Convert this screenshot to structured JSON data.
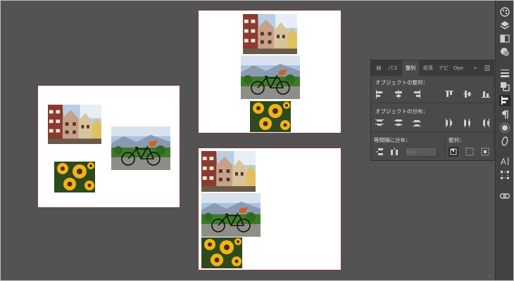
{
  "panel": {
    "tabs": [
      {
        "label": "線",
        "active": false
      },
      {
        "label": "パス",
        "active": false
      },
      {
        "label": "整列",
        "active": true
      },
      {
        "label": "段落",
        "active": false
      },
      {
        "label": "アピ",
        "active": false
      },
      {
        "label": "Ope",
        "active": false
      }
    ],
    "more": "»",
    "menu_icon": "panel-menu-icon",
    "align_objects_label": "オブジェクトの整列：",
    "distribute_objects_label": "オブジェクトの分布：",
    "distribute_spacing_label": "等間隔に分布：",
    "align_to_label": "整列：",
    "spacing_value": "0 px"
  },
  "toolbar_icons": [
    "color-palette-icon",
    "layers-icon",
    "gradient-icon",
    "appearance-icon",
    "stroke-icon",
    "pathfinder-icon",
    "align-icon",
    "paragraph-icon",
    "brightness-icon",
    "glyph-icon",
    "character-icon",
    "transform-icon",
    "links-icon"
  ],
  "colors": {
    "canvas": "#535353",
    "artboard_border": "#6a4848",
    "panel_bg": "#4a4a4a",
    "toolbar_bg": "#434343"
  }
}
